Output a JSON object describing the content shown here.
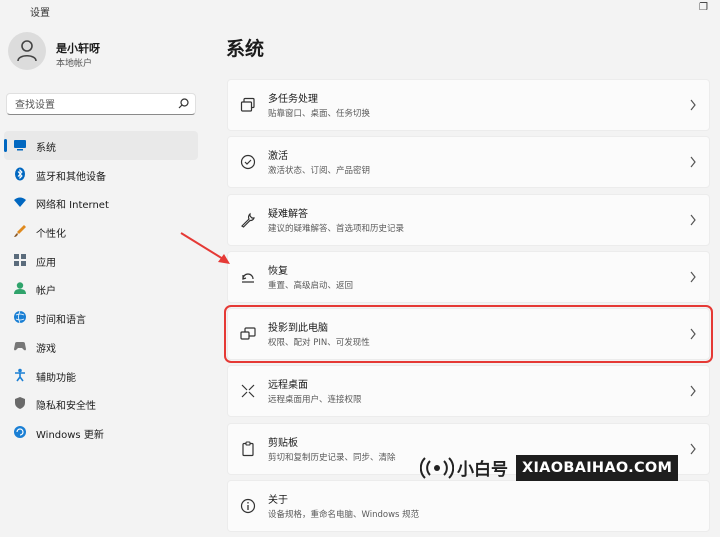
{
  "window": {
    "title": "设置"
  },
  "profile": {
    "name": "是小轩呀",
    "account_type": "本地帐户"
  },
  "search": {
    "placeholder": "查找设置"
  },
  "nav": {
    "items": [
      {
        "label": "系统",
        "icon": "display-icon",
        "color": "#0067c0",
        "active": true
      },
      {
        "label": "蓝牙和其他设备",
        "icon": "bluetooth-icon",
        "color": "#0067c0"
      },
      {
        "label": "网络和 Internet",
        "icon": "wifi-icon",
        "color": "#0067c0"
      },
      {
        "label": "个性化",
        "icon": "brush-icon",
        "color": "#e08a1e"
      },
      {
        "label": "应用",
        "icon": "apps-icon",
        "color": "#5a6b7b"
      },
      {
        "label": "帐户",
        "icon": "person-icon",
        "color": "#2fa36b"
      },
      {
        "label": "时间和语言",
        "icon": "globe-icon",
        "color": "#1a7fd4"
      },
      {
        "label": "游戏",
        "icon": "gamepad-icon",
        "color": "#777777"
      },
      {
        "label": "辅助功能",
        "icon": "accessibility-icon",
        "color": "#1a7fd4"
      },
      {
        "label": "隐私和安全性",
        "icon": "shield-icon",
        "color": "#6a6a6a"
      },
      {
        "label": "Windows 更新",
        "icon": "update-icon",
        "color": "#1a7fd4"
      }
    ]
  },
  "main": {
    "title": "系统",
    "cards": [
      {
        "title": "多任务处理",
        "subtitle": "贴靠窗口、桌面、任务切换",
        "icon": "multitask-icon"
      },
      {
        "title": "激活",
        "subtitle": "激活状态、订阅、产品密钥",
        "icon": "check-circle-icon"
      },
      {
        "title": "疑难解答",
        "subtitle": "建议的疑难解答、首选项和历史记录",
        "icon": "wrench-icon"
      },
      {
        "title": "恢复",
        "subtitle": "重置、高级启动、返回",
        "icon": "recovery-icon"
      },
      {
        "title": "投影到此电脑",
        "subtitle": "权限、配对 PIN、可发现性",
        "icon": "project-icon",
        "highlighted": true
      },
      {
        "title": "远程桌面",
        "subtitle": "远程桌面用户、连接权限",
        "icon": "remote-desktop-icon"
      },
      {
        "title": "剪贴板",
        "subtitle": "剪切和复制历史记录、同步、清除",
        "icon": "clipboard-icon"
      },
      {
        "title": "关于",
        "subtitle": "设备规格，重命名电脑、Windows 规范",
        "icon": "info-icon"
      }
    ]
  },
  "watermark": {
    "logo_text": "小白号",
    "brand": "XIAOBAIHAO.COM"
  },
  "colors": {
    "accent": "#0067c0",
    "highlight": "#e53935"
  }
}
